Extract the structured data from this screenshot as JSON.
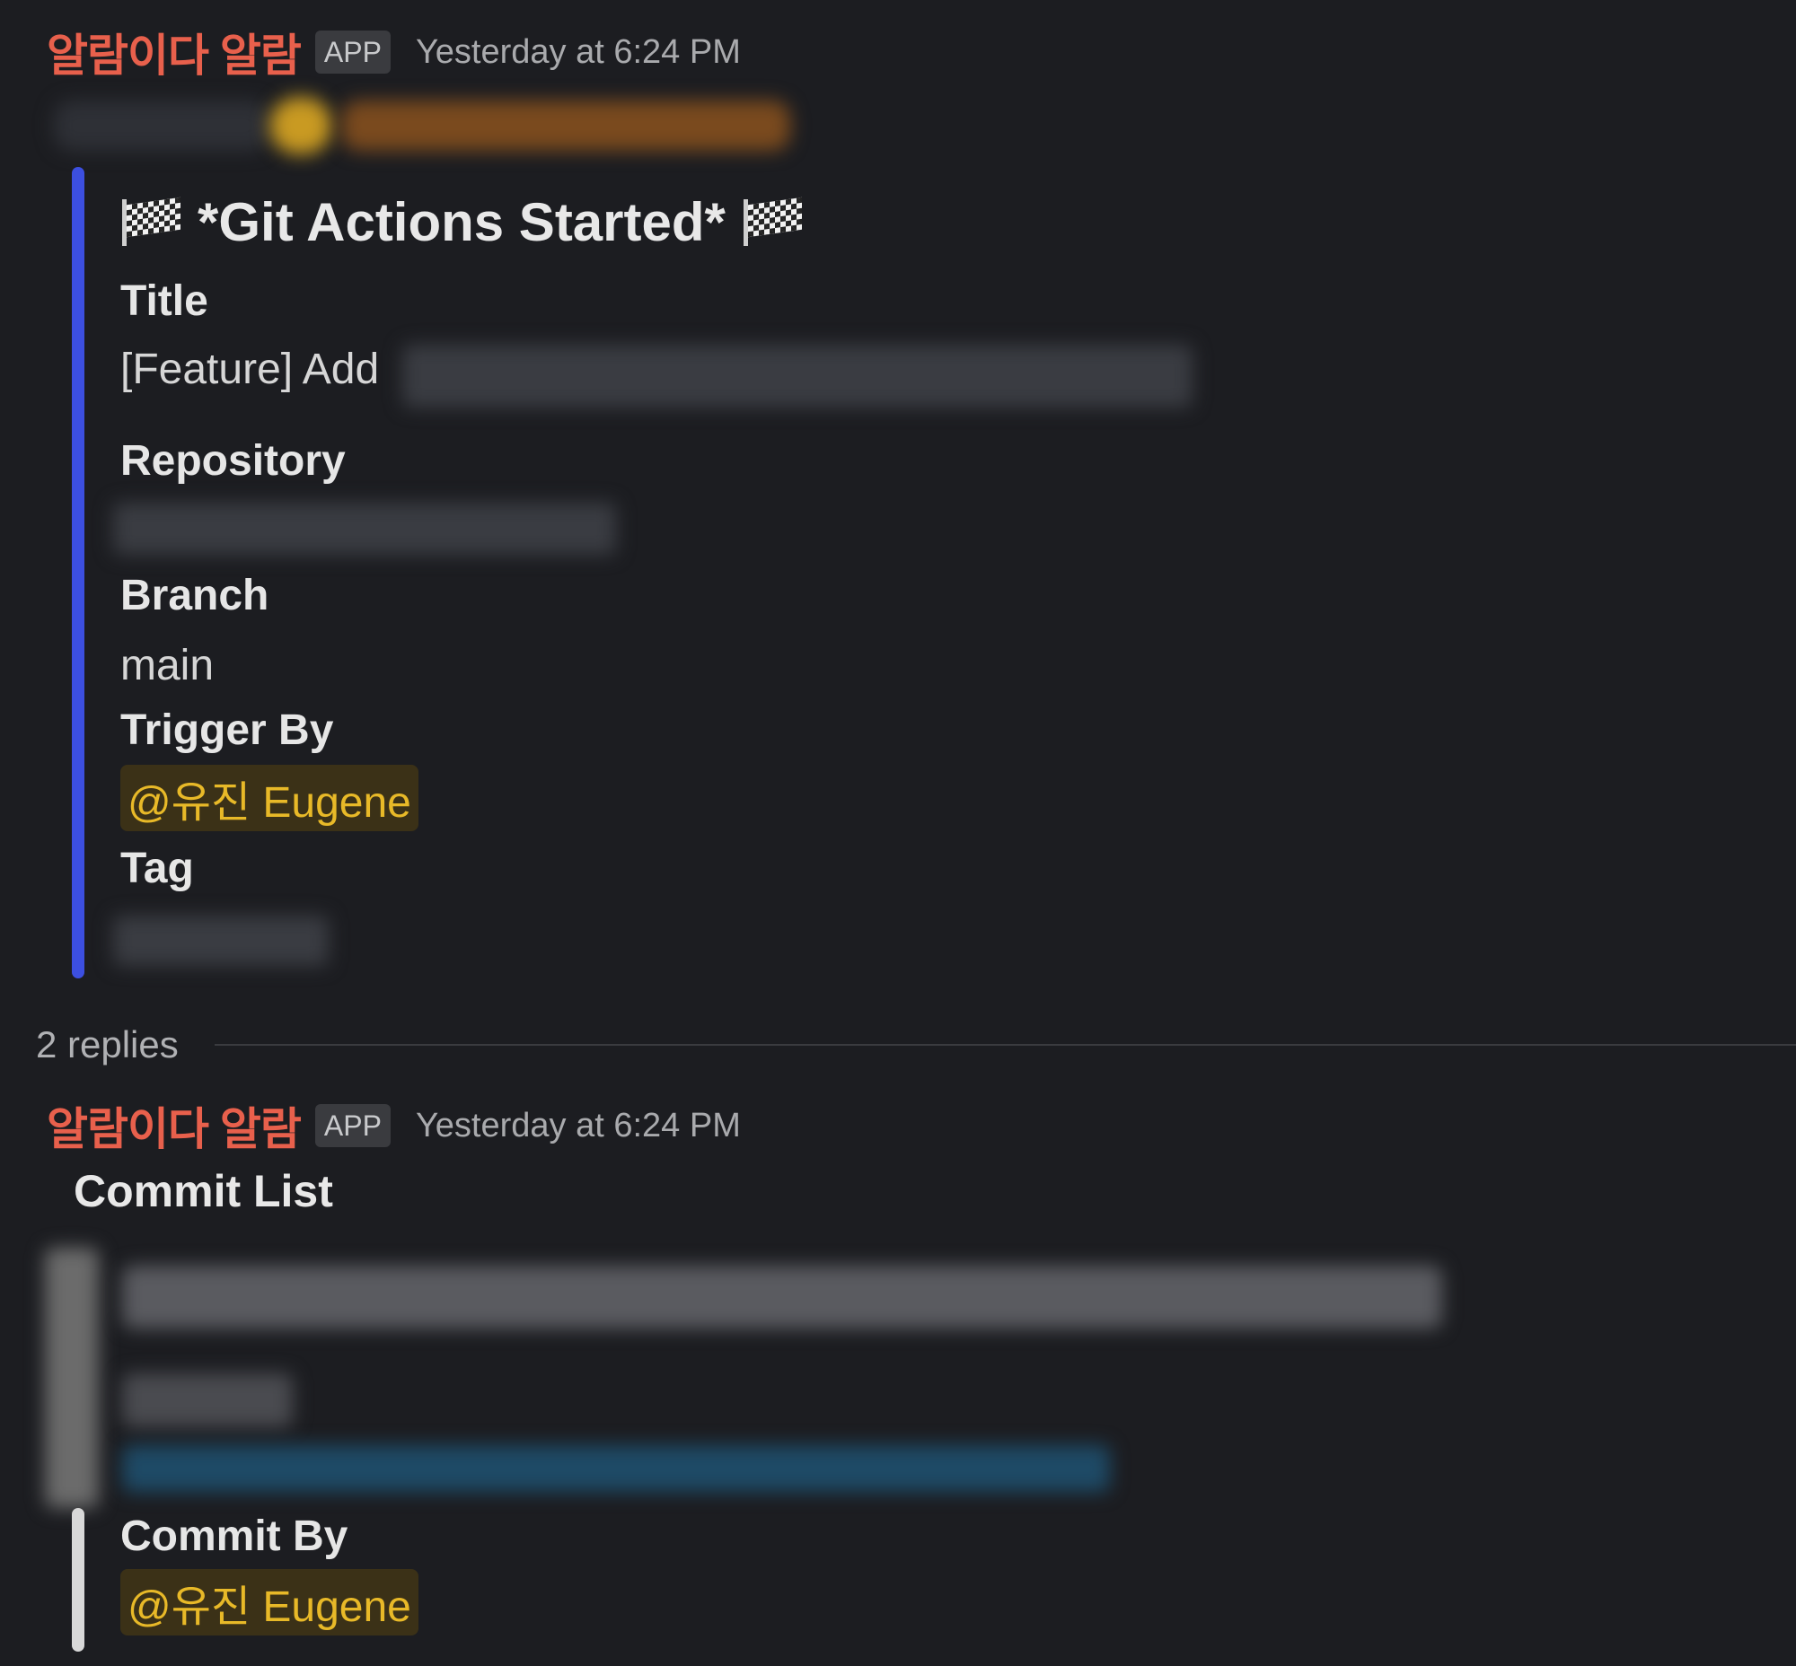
{
  "message1": {
    "sender": "알람이다 알람",
    "badge": "APP",
    "timestamp": "Yesterday at 6:24 PM",
    "heading": "*Git Actions Started*",
    "fields": {
      "title_label": "Title",
      "title_value": "[Feature] Add",
      "repository_label": "Repository",
      "branch_label": "Branch",
      "branch_value": "main",
      "trigger_label": "Trigger By",
      "trigger_value": "@유진 Eugene",
      "tag_label": "Tag"
    },
    "accent_color": "#3c4fe0"
  },
  "replies": {
    "count_text": "2 replies"
  },
  "message2": {
    "sender": "알람이다 알람",
    "badge": "APP",
    "timestamp": "Yesterday at 6:24 PM",
    "commit_list_label": "Commit List",
    "commit_by_label": "Commit By",
    "commit_by_value": "@유진 Eugene",
    "accent_color": "#d8d8d8"
  },
  "colors": {
    "background": "#1c1d21",
    "sender": "#e8604c",
    "mention_text": "#e8b928",
    "mention_bg": "#3b3117"
  }
}
